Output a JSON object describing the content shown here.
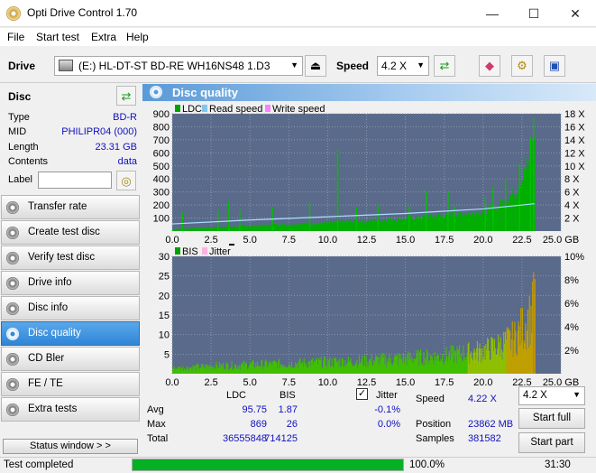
{
  "window": {
    "title": "Opti Drive Control 1.70",
    "minimize": "—",
    "maximize": "☐",
    "close": "✕"
  },
  "menu": [
    "File",
    "Start test",
    "Extra",
    "Help"
  ],
  "toolbar": {
    "drive_label": "Drive",
    "drive_value": "(E:)  HL-DT-ST BD-RE  WH16NS48 1.D3",
    "speed_label": "Speed",
    "speed_value": "4.2 X"
  },
  "disc": {
    "header": "Disc",
    "rows": [
      {
        "key": "Type",
        "value": "BD-R"
      },
      {
        "key": "MID",
        "value": "PHILIPR04 (000)"
      },
      {
        "key": "Length",
        "value": "23.31 GB"
      },
      {
        "key": "Contents",
        "value": "data"
      }
    ],
    "label_key": "Label",
    "label_value": ""
  },
  "nav": [
    {
      "label": "Transfer rate",
      "active": false
    },
    {
      "label": "Create test disc",
      "active": false
    },
    {
      "label": "Verify test disc",
      "active": false
    },
    {
      "label": "Drive info",
      "active": false
    },
    {
      "label": "Disc info",
      "active": false
    },
    {
      "label": "Disc quality",
      "active": true
    },
    {
      "label": "CD Bler",
      "active": false
    },
    {
      "label": "FE / TE",
      "active": false
    },
    {
      "label": "Extra tests",
      "active": false
    }
  ],
  "status_window_label": "Status window > >",
  "main_title": "Disc quality",
  "chart_data": [
    {
      "type": "bar",
      "title": "LDC / Read speed",
      "legend": [
        "LDC",
        "Read speed",
        "Write speed"
      ],
      "legend_colors": [
        "#00a000",
        "#7ec8f0",
        "#ff80ff"
      ],
      "x_ticks": [
        "0.0",
        "2.5",
        "5.0",
        "7.5",
        "10.0",
        "12.5",
        "15.0",
        "17.5",
        "20.0",
        "22.5",
        "25.0 GB"
      ],
      "xlim": [
        0,
        25
      ],
      "y_ticks": [
        "100",
        "200",
        "300",
        "400",
        "500",
        "600",
        "700",
        "800",
        "900"
      ],
      "ylim": [
        0,
        900
      ],
      "y2_ticks": [
        "2 X",
        "4 X",
        "6 X",
        "8 X",
        "10 X",
        "12 X",
        "14 X",
        "16 X",
        "18 X"
      ],
      "y2lim": [
        0,
        18
      ],
      "ldc_baseline": [
        [
          0,
          15
        ],
        [
          5,
          40
        ],
        [
          10,
          65
        ],
        [
          15,
          95
        ],
        [
          20,
          150
        ],
        [
          21,
          200
        ],
        [
          22,
          300
        ],
        [
          22.5,
          400
        ],
        [
          23,
          550
        ],
        [
          23.31,
          700
        ]
      ],
      "ldc_spikes": [
        [
          0.6,
          150
        ],
        [
          2.9,
          160
        ],
        [
          3.6,
          230
        ],
        [
          4.3,
          160
        ],
        [
          6.4,
          180
        ],
        [
          8.8,
          220
        ],
        [
          10.6,
          620
        ],
        [
          11.8,
          180
        ],
        [
          13.2,
          200
        ],
        [
          15.2,
          190
        ],
        [
          16.3,
          310
        ],
        [
          17.7,
          300
        ],
        [
          18.1,
          190
        ],
        [
          20.1,
          260
        ],
        [
          20.6,
          340
        ],
        [
          21.4,
          400
        ],
        [
          22.3,
          520
        ],
        [
          23.0,
          720
        ],
        [
          23.2,
          869
        ]
      ],
      "read_speed": [
        [
          0,
          1.1
        ],
        [
          5,
          1.7
        ],
        [
          10,
          2.2
        ],
        [
          15,
          2.7
        ],
        [
          20,
          3.4
        ],
        [
          23.31,
          4.2
        ]
      ]
    },
    {
      "type": "bar",
      "title": "BIS / Jitter",
      "legend": [
        "BIS",
        "Jitter"
      ],
      "legend_colors": [
        "#00a000",
        "#ffb0e0"
      ],
      "x_ticks": [
        "0.0",
        "2.5",
        "5.0",
        "7.5",
        "10.0",
        "12.5",
        "15.0",
        "17.5",
        "20.0",
        "22.5",
        "25.0 GB"
      ],
      "xlim": [
        0,
        25
      ],
      "y_ticks": [
        "5",
        "10",
        "15",
        "20",
        "25",
        "30"
      ],
      "ylim": [
        0,
        30
      ],
      "y2_ticks": [
        "2%",
        "4%",
        "6%",
        "8%",
        "10%"
      ],
      "y2lim": [
        0,
        10
      ],
      "bis_envelope": [
        [
          0,
          2
        ],
        [
          2.5,
          3
        ],
        [
          5,
          3.5
        ],
        [
          7.5,
          4
        ],
        [
          10,
          4.5
        ],
        [
          12.5,
          5
        ],
        [
          15,
          6
        ],
        [
          17.5,
          7
        ],
        [
          20,
          9
        ],
        [
          21,
          11
        ],
        [
          22,
          14
        ],
        [
          22.5,
          18
        ],
        [
          23,
          22
        ],
        [
          23.31,
          26
        ]
      ]
    }
  ],
  "stats": {
    "col_ldc": "LDC",
    "col_bis": "BIS",
    "jitter_label": "Jitter",
    "jitter_checked": true,
    "rows": [
      {
        "label": "Avg",
        "ldc": "95.75",
        "bis": "1.87",
        "jitter": "-0.1%"
      },
      {
        "label": "Max",
        "ldc": "869",
        "bis": "26",
        "jitter": "0.0%"
      },
      {
        "label": "Total",
        "ldc": "36555848",
        "bis": "714125",
        "jitter": ""
      }
    ],
    "speed_label": "Speed",
    "speed_value": "4.22 X",
    "position_label": "Position",
    "position_value": "23862 MB",
    "samples_label": "Samples",
    "samples_value": "381582",
    "speed_select": "4.2 X",
    "start_full": "Start full",
    "start_part": "Start part"
  },
  "statusbar": {
    "text": "Test completed",
    "progress": 100.0,
    "progress_text": "100.0%",
    "time": "31:30"
  }
}
